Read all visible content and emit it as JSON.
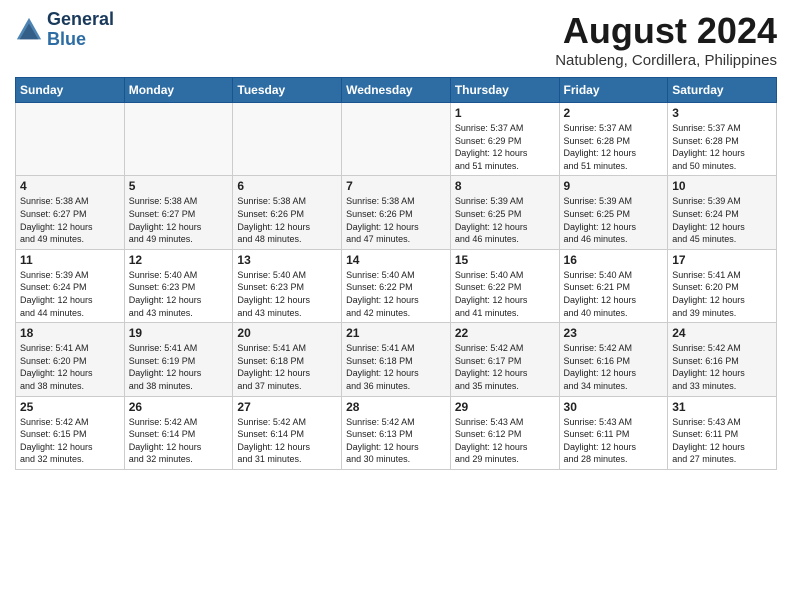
{
  "header": {
    "logo_line1": "General",
    "logo_line2": "Blue",
    "main_title": "August 2024",
    "subtitle": "Natubleng, Cordillera, Philippines"
  },
  "days_of_week": [
    "Sunday",
    "Monday",
    "Tuesday",
    "Wednesday",
    "Thursday",
    "Friday",
    "Saturday"
  ],
  "weeks": [
    [
      {
        "day": "",
        "info": ""
      },
      {
        "day": "",
        "info": ""
      },
      {
        "day": "",
        "info": ""
      },
      {
        "day": "",
        "info": ""
      },
      {
        "day": "1",
        "info": "Sunrise: 5:37 AM\nSunset: 6:29 PM\nDaylight: 12 hours\nand 51 minutes."
      },
      {
        "day": "2",
        "info": "Sunrise: 5:37 AM\nSunset: 6:28 PM\nDaylight: 12 hours\nand 51 minutes."
      },
      {
        "day": "3",
        "info": "Sunrise: 5:37 AM\nSunset: 6:28 PM\nDaylight: 12 hours\nand 50 minutes."
      }
    ],
    [
      {
        "day": "4",
        "info": "Sunrise: 5:38 AM\nSunset: 6:27 PM\nDaylight: 12 hours\nand 49 minutes."
      },
      {
        "day": "5",
        "info": "Sunrise: 5:38 AM\nSunset: 6:27 PM\nDaylight: 12 hours\nand 49 minutes."
      },
      {
        "day": "6",
        "info": "Sunrise: 5:38 AM\nSunset: 6:26 PM\nDaylight: 12 hours\nand 48 minutes."
      },
      {
        "day": "7",
        "info": "Sunrise: 5:38 AM\nSunset: 6:26 PM\nDaylight: 12 hours\nand 47 minutes."
      },
      {
        "day": "8",
        "info": "Sunrise: 5:39 AM\nSunset: 6:25 PM\nDaylight: 12 hours\nand 46 minutes."
      },
      {
        "day": "9",
        "info": "Sunrise: 5:39 AM\nSunset: 6:25 PM\nDaylight: 12 hours\nand 46 minutes."
      },
      {
        "day": "10",
        "info": "Sunrise: 5:39 AM\nSunset: 6:24 PM\nDaylight: 12 hours\nand 45 minutes."
      }
    ],
    [
      {
        "day": "11",
        "info": "Sunrise: 5:39 AM\nSunset: 6:24 PM\nDaylight: 12 hours\nand 44 minutes."
      },
      {
        "day": "12",
        "info": "Sunrise: 5:40 AM\nSunset: 6:23 PM\nDaylight: 12 hours\nand 43 minutes."
      },
      {
        "day": "13",
        "info": "Sunrise: 5:40 AM\nSunset: 6:23 PM\nDaylight: 12 hours\nand 43 minutes."
      },
      {
        "day": "14",
        "info": "Sunrise: 5:40 AM\nSunset: 6:22 PM\nDaylight: 12 hours\nand 42 minutes."
      },
      {
        "day": "15",
        "info": "Sunrise: 5:40 AM\nSunset: 6:22 PM\nDaylight: 12 hours\nand 41 minutes."
      },
      {
        "day": "16",
        "info": "Sunrise: 5:40 AM\nSunset: 6:21 PM\nDaylight: 12 hours\nand 40 minutes."
      },
      {
        "day": "17",
        "info": "Sunrise: 5:41 AM\nSunset: 6:20 PM\nDaylight: 12 hours\nand 39 minutes."
      }
    ],
    [
      {
        "day": "18",
        "info": "Sunrise: 5:41 AM\nSunset: 6:20 PM\nDaylight: 12 hours\nand 38 minutes."
      },
      {
        "day": "19",
        "info": "Sunrise: 5:41 AM\nSunset: 6:19 PM\nDaylight: 12 hours\nand 38 minutes."
      },
      {
        "day": "20",
        "info": "Sunrise: 5:41 AM\nSunset: 6:18 PM\nDaylight: 12 hours\nand 37 minutes."
      },
      {
        "day": "21",
        "info": "Sunrise: 5:41 AM\nSunset: 6:18 PM\nDaylight: 12 hours\nand 36 minutes."
      },
      {
        "day": "22",
        "info": "Sunrise: 5:42 AM\nSunset: 6:17 PM\nDaylight: 12 hours\nand 35 minutes."
      },
      {
        "day": "23",
        "info": "Sunrise: 5:42 AM\nSunset: 6:16 PM\nDaylight: 12 hours\nand 34 minutes."
      },
      {
        "day": "24",
        "info": "Sunrise: 5:42 AM\nSunset: 6:16 PM\nDaylight: 12 hours\nand 33 minutes."
      }
    ],
    [
      {
        "day": "25",
        "info": "Sunrise: 5:42 AM\nSunset: 6:15 PM\nDaylight: 12 hours\nand 32 minutes."
      },
      {
        "day": "26",
        "info": "Sunrise: 5:42 AM\nSunset: 6:14 PM\nDaylight: 12 hours\nand 32 minutes."
      },
      {
        "day": "27",
        "info": "Sunrise: 5:42 AM\nSunset: 6:14 PM\nDaylight: 12 hours\nand 31 minutes."
      },
      {
        "day": "28",
        "info": "Sunrise: 5:42 AM\nSunset: 6:13 PM\nDaylight: 12 hours\nand 30 minutes."
      },
      {
        "day": "29",
        "info": "Sunrise: 5:43 AM\nSunset: 6:12 PM\nDaylight: 12 hours\nand 29 minutes."
      },
      {
        "day": "30",
        "info": "Sunrise: 5:43 AM\nSunset: 6:11 PM\nDaylight: 12 hours\nand 28 minutes."
      },
      {
        "day": "31",
        "info": "Sunrise: 5:43 AM\nSunset: 6:11 PM\nDaylight: 12 hours\nand 27 minutes."
      }
    ]
  ]
}
